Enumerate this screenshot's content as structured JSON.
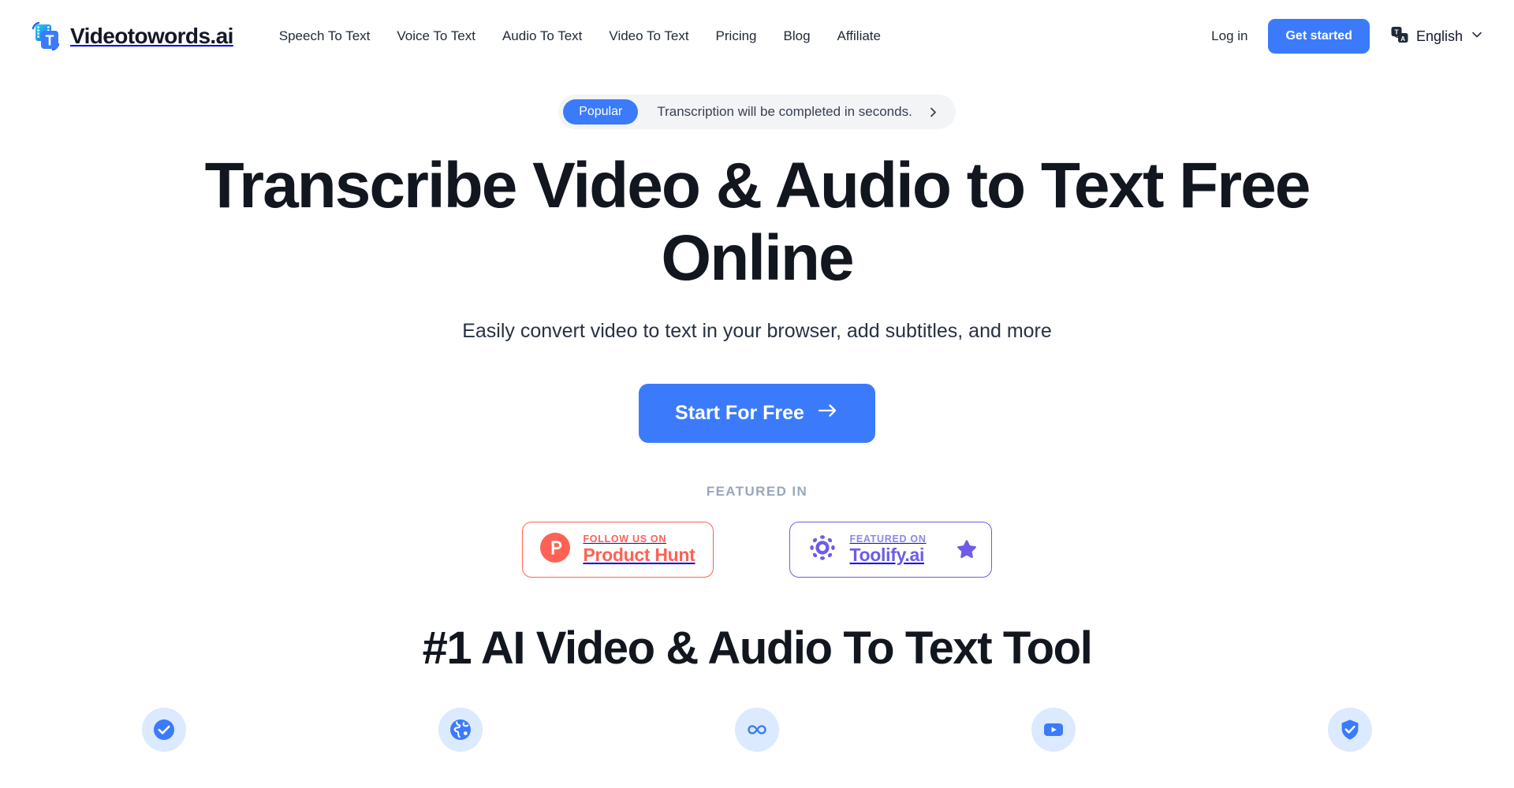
{
  "brand": {
    "logo_icon": "videotowords-film-text-logo",
    "name": "Videotowords",
    "suffix": ".ai"
  },
  "header": {
    "nav_items": [
      {
        "label": "Speech To Text",
        "name": "speech-to-text"
      },
      {
        "label": "Voice To Text",
        "name": "voice-to-text"
      },
      {
        "label": "Audio To Text",
        "name": "audio-to-text"
      },
      {
        "label": "Video To Text",
        "name": "video-to-text"
      },
      {
        "label": "Pricing",
        "name": "pricing"
      },
      {
        "label": "Blog",
        "name": "blog"
      },
      {
        "label": "Affiliate",
        "name": "affiliate"
      }
    ],
    "login_label": "Log in",
    "get_started_label": "Get started",
    "language": {
      "icon": "translate-icon",
      "label": "English",
      "chevron": "chevron-down-icon"
    }
  },
  "hero": {
    "announcement": {
      "badge": "Popular",
      "text": "Transcription will be completed in seconds.",
      "arrow_icon": "chevron-right-icon"
    },
    "title": "Transcribe Video & Audio to Text Free Online",
    "subtitle": "Easily convert video to text in your browser, add subtitles, and more",
    "cta_label": "Start For Free",
    "cta_arrow_icon": "arrow-right-icon"
  },
  "featured": {
    "label": "FEATURED IN",
    "badges": [
      {
        "name": "product-hunt",
        "icon": "product-hunt-icon",
        "top_text": "FOLLOW US ON",
        "main_text": "Product Hunt",
        "color": "#ff6154"
      },
      {
        "name": "toolify",
        "icon": "toolify-icon",
        "top_text": "FEATURED ON",
        "main_text": "Toolify.ai",
        "color": "#6c5ce7",
        "star_icon": "star-icon"
      }
    ]
  },
  "highlights": {
    "title": "#1 AI Video & Audio To Text Tool",
    "icons": [
      {
        "name": "check-circle-icon"
      },
      {
        "name": "globe-icon"
      },
      {
        "name": "infinity-icon"
      },
      {
        "name": "video-play-icon"
      },
      {
        "name": "shield-check-icon"
      }
    ]
  },
  "colors": {
    "accent_blue": "#3b7bfb",
    "icon_chip_bg": "#dbeafe",
    "product_hunt": "#ff6154",
    "toolify": "#6c5ce7",
    "featured_label": "#9aa6bd"
  }
}
